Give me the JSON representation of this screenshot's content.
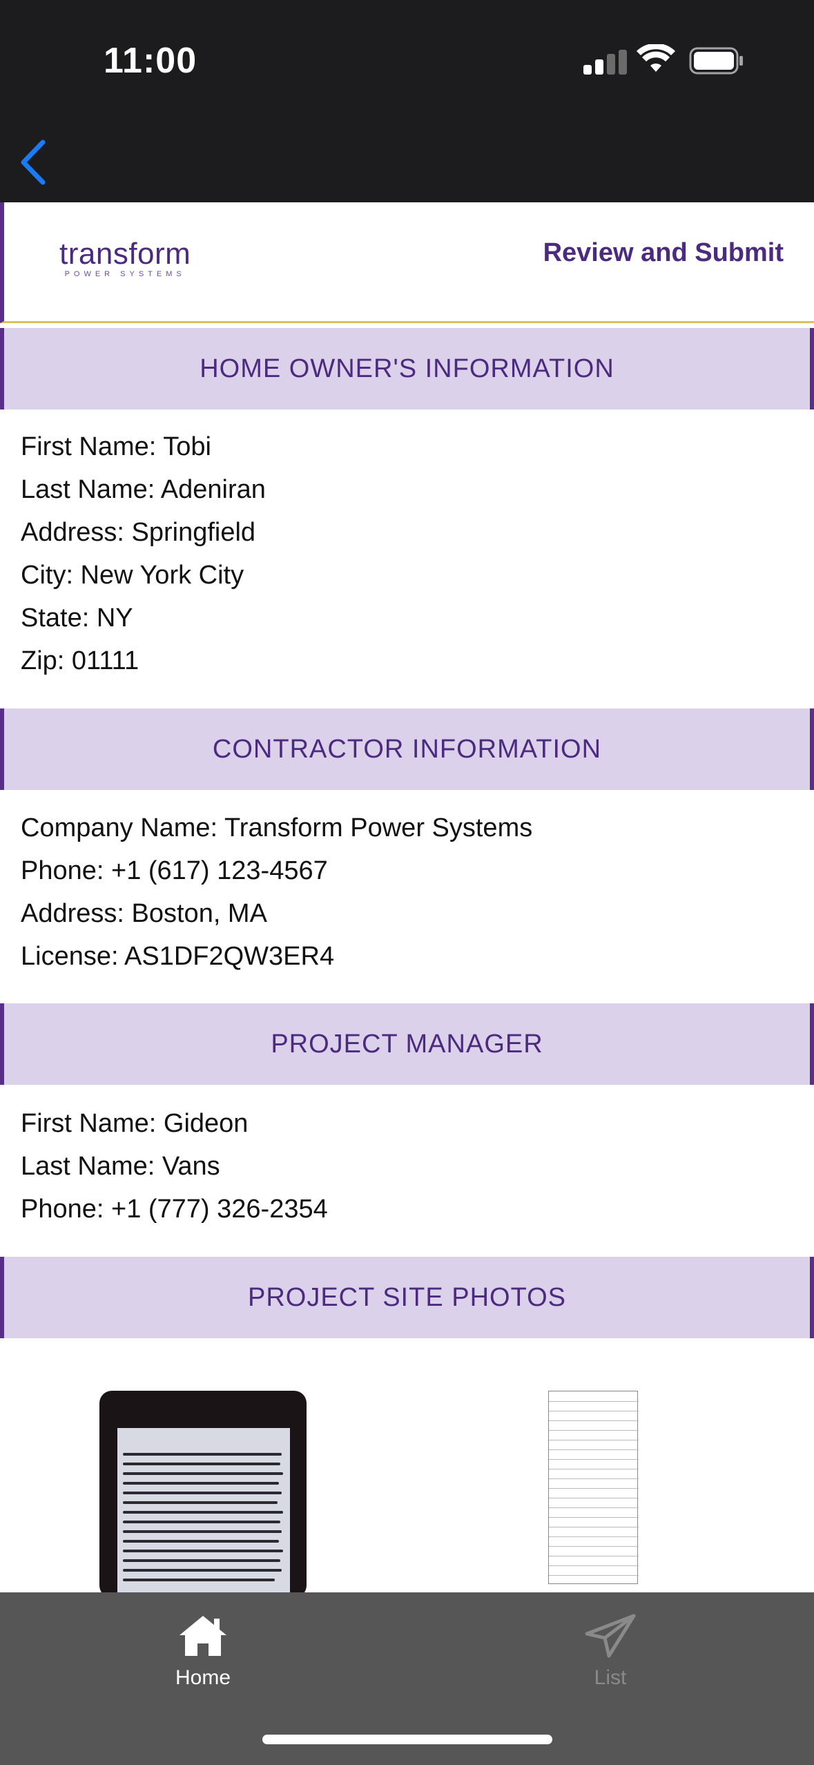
{
  "status_bar": {
    "time": "11:00"
  },
  "header": {
    "logo_text": "transform",
    "logo_sub": "POWER SYSTEMS",
    "review_link": "Review and Submit"
  },
  "homeowner": {
    "title": "HOME OWNER'S INFORMATION",
    "first_name": "First Name: Tobi",
    "last_name": "Last Name: Adeniran",
    "address": "Address: Springfield",
    "city": "City: New York City",
    "state": "State: NY",
    "zip": "Zip: 01111"
  },
  "contractor": {
    "title": "CONTRACTOR INFORMATION",
    "company": "Company Name: Transform Power Systems",
    "phone": "Phone: +1 (617) 123-4567",
    "address": "Address: Boston, MA",
    "license": "License: AS1DF2QW3ER4"
  },
  "project_manager": {
    "title": "PROJECT MANAGER",
    "first_name": "First Name: Gideon",
    "last_name": "Last Name: Vans",
    "phone": "Phone: +1 (777) 326-2354"
  },
  "photos": {
    "title": "PROJECT SITE PHOTOS"
  },
  "tabbar": {
    "home_label": "Home",
    "list_label": "List",
    "active_color": "#ffffff",
    "inactive_color": "#8a8a8a"
  }
}
